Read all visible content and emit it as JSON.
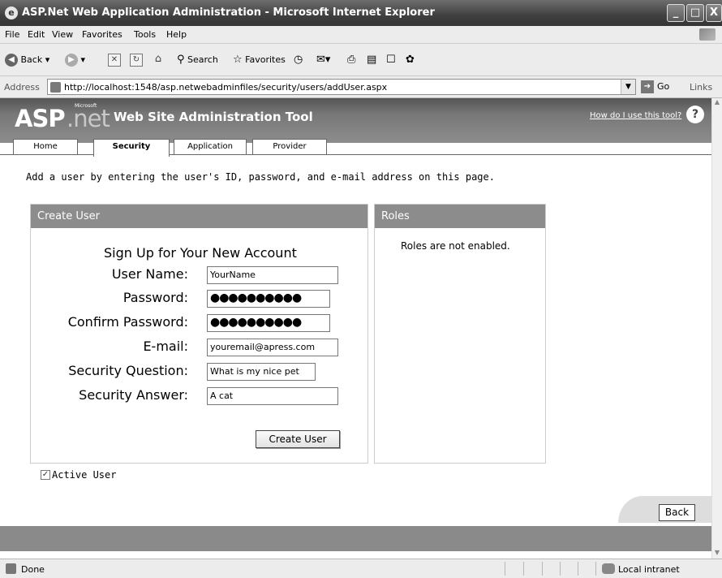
{
  "window": {
    "title": "ASP.Net Web Application Administration - Microsoft Internet Explorer",
    "controls": {
      "minimize": "_",
      "maximize": "□",
      "close": "X"
    }
  },
  "menu": {
    "items": [
      "File",
      "Edit",
      "View",
      "Favorites",
      "Tools",
      "Help"
    ]
  },
  "toolbar": {
    "back": "Back",
    "search": "Search",
    "favorites": "Favorites"
  },
  "address": {
    "label": "Address",
    "url": "http://localhost:1548/asp.netwebadminfiles/security/users/addUser.aspx",
    "go": "Go",
    "links": "Links"
  },
  "header": {
    "logo_asp": "ASP",
    "logo_net": ".net",
    "logo_ms": "Microsoft",
    "title": "Web Site Administration Tool",
    "help_link": "How do I use this tool?",
    "help_icon": "?"
  },
  "tabs": [
    {
      "label": "Home",
      "active": false
    },
    {
      "label": "Security",
      "active": true
    },
    {
      "label": "Application",
      "active": false
    },
    {
      "label": "Provider",
      "active": false
    }
  ],
  "intro": "Add a user by entering the user's ID, password, and e-mail address on this page.",
  "create_user": {
    "heading": "Create User",
    "form_title": "Sign Up for Your New Account",
    "fields": [
      {
        "label": "User Name:",
        "value": "YourName"
      },
      {
        "label": "Password:",
        "value": "●●●●●●●●●●"
      },
      {
        "label": "Confirm Password:",
        "value": "●●●●●●●●●●"
      },
      {
        "label": "E-mail:",
        "value": "youremail@apress.com"
      },
      {
        "label": "Security Question:",
        "value": "What is my nice pet"
      },
      {
        "label": "Security Answer:",
        "value": "A cat"
      }
    ],
    "submit": "Create User"
  },
  "roles": {
    "heading": "Roles",
    "message": "Roles are not enabled."
  },
  "active_user": {
    "label": "Active User",
    "checked": true
  },
  "back_button": "Back",
  "status": {
    "text": "Done",
    "zone": "Local intranet"
  }
}
